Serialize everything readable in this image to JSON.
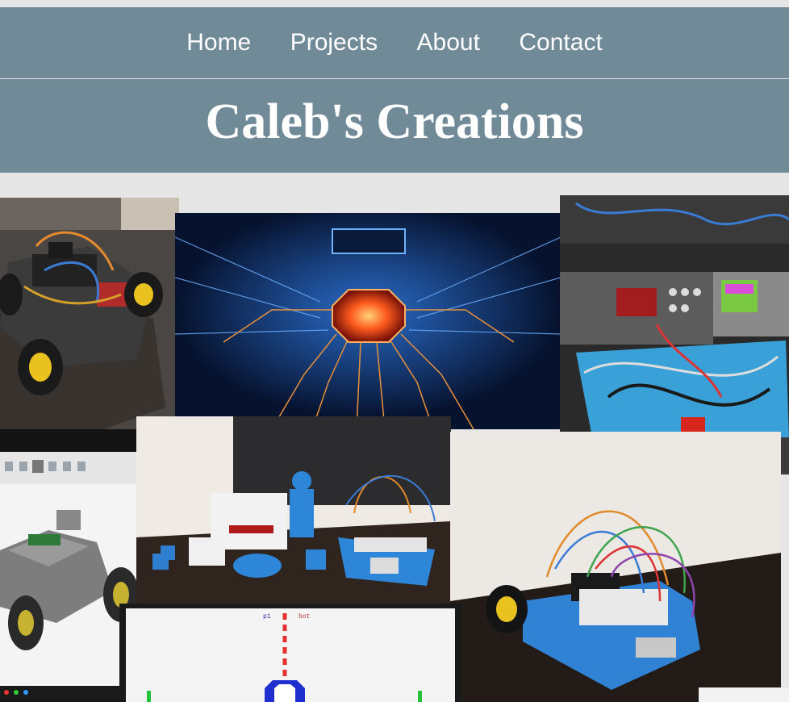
{
  "nav": {
    "items": [
      {
        "label": "Home"
      },
      {
        "label": "Projects"
      },
      {
        "label": "About"
      },
      {
        "label": "Contact"
      }
    ]
  },
  "header": {
    "title": "Caleb's Creations"
  },
  "collage": {
    "photos": [
      {
        "name": "robot-car-photo"
      },
      {
        "name": "circuit-board-image"
      },
      {
        "name": "lab-equipment-photo"
      },
      {
        "name": "cad-robot-model-screenshot"
      },
      {
        "name": "3d-printed-figures-photo"
      },
      {
        "name": "blue-robot-car-photo"
      },
      {
        "name": "pong-game-screenshot"
      }
    ],
    "game_scores": {
      "left": "p1",
      "right": "bot"
    }
  }
}
